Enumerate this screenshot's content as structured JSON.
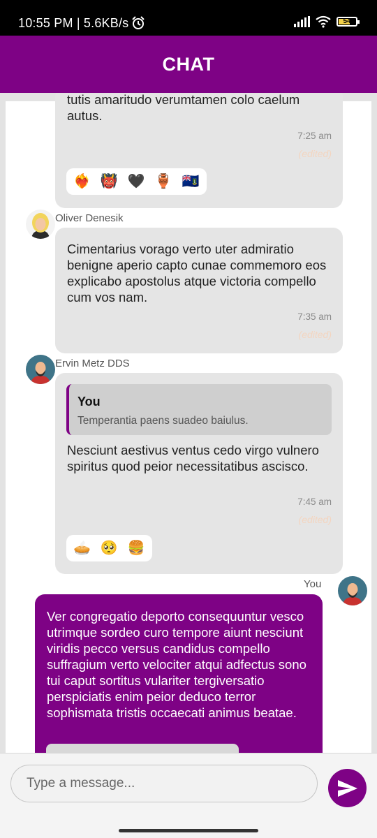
{
  "status_bar": {
    "time_and_speed": "10:55 PM | 5.6KB/s",
    "battery": "54"
  },
  "app_bar": {
    "title": "CHAT"
  },
  "colors": {
    "accent": "#7e0285",
    "incoming_bubble": "#e5e5e5",
    "edited_label": "#f3d5c0"
  },
  "messages": [
    {
      "text": "tutis amaritudo verumtamen colo caelum autus.",
      "time": "7:25 am",
      "edited": "(edited)",
      "reactions": [
        "❤️‍🔥",
        "👹",
        "🖤",
        "🏺",
        "🇻🇬"
      ]
    },
    {
      "sender": "Oliver Denesik",
      "text": "Cimentarius vorago verto uter admiratio benigne aperio capto cunae commemoro eos explicabo apostolus atque victoria compello cum vos nam.",
      "time": "7:35 am",
      "edited": "(edited)"
    },
    {
      "sender": "Ervin Metz DDS",
      "reply_to": {
        "name": "You",
        "text": "Temperantia paens suadeo baiulus."
      },
      "text": "Nesciunt aestivus ventus cedo virgo vulnero spiritus quod peior necessitatibus ascisco.",
      "time": "7:45 am",
      "edited": "(edited)",
      "reactions": [
        "🥧",
        "🥺",
        "🍔"
      ]
    },
    {
      "sender": "You",
      "text": "Ver congregatio deporto consequuntur vesco utrimque sordeo curo tempore aiunt nesciunt viridis pecco versus candidus compello suffragium verto velociter atqui adfectus sono tui caput sortitus vulariter tergiversatio perspiciatis enim peior deduco terror sophismata tristis occaecati animus beatae."
    }
  ],
  "composer": {
    "placeholder": "Type a message...",
    "send_icon": "send-icon"
  }
}
